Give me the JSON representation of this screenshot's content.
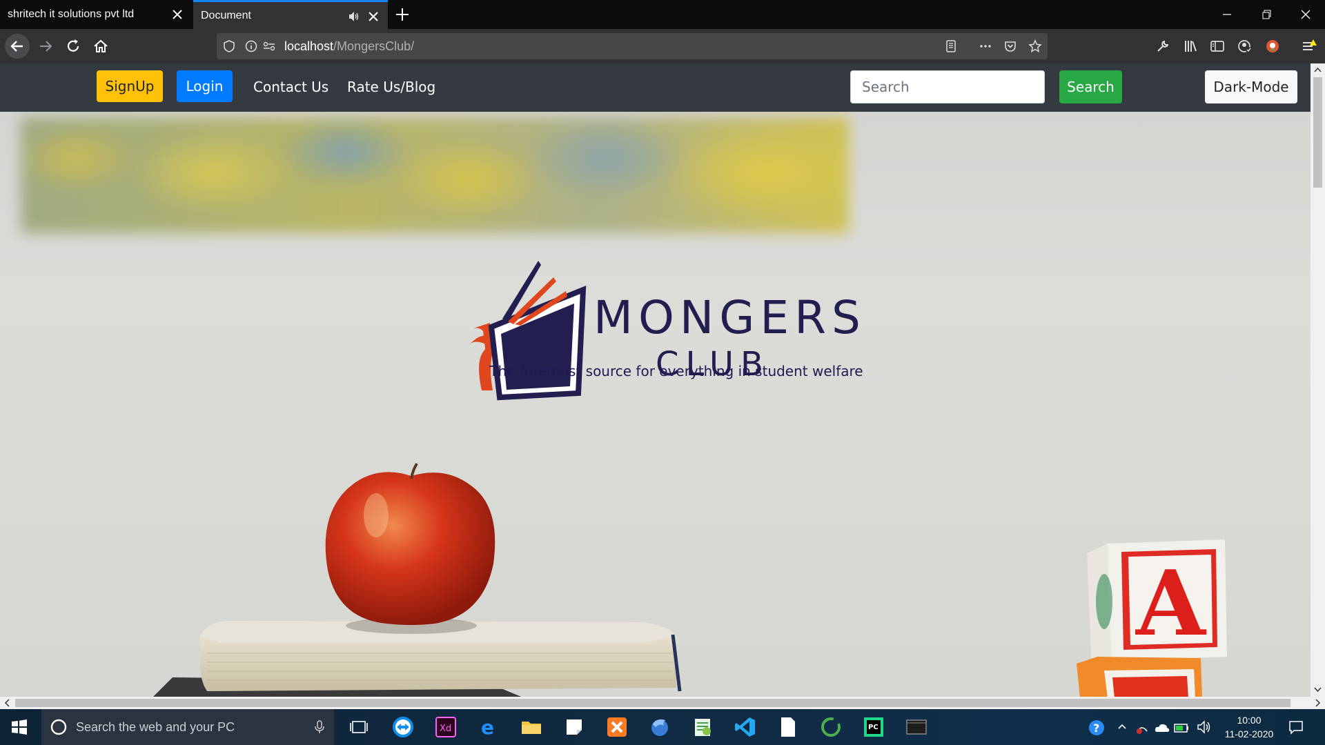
{
  "browser": {
    "tabs": [
      {
        "title": "shritech it solutions pvt ltd",
        "active": false
      },
      {
        "title": "Document",
        "active": true
      }
    ],
    "url": {
      "host": "localhost",
      "path": "/MongersClub/"
    }
  },
  "site": {
    "nav": {
      "signup_label": "SignUp",
      "login_label": "Login",
      "contact_label": "Contact Us",
      "rate_label": "Rate Us/Blog",
      "search_placeholder": "Search",
      "search_button_label": "Search",
      "dark_mode_label": "Dark-Mode"
    },
    "logo": {
      "line1": "MONGERS",
      "line2": "CLUB"
    },
    "tagline": "The foremost source for everything in student welfare",
    "blocks": {
      "letter": "A"
    },
    "colors": {
      "navbar": "#343a40",
      "signup": "#ffc107",
      "login": "#007bff",
      "search": "#28a745",
      "logo_navy": "#221e4f",
      "logo_orange": "#e0471e"
    }
  },
  "taskbar": {
    "search_placeholder": "Search the web and your PC",
    "time": "10:00",
    "date": "11-02-2020"
  }
}
